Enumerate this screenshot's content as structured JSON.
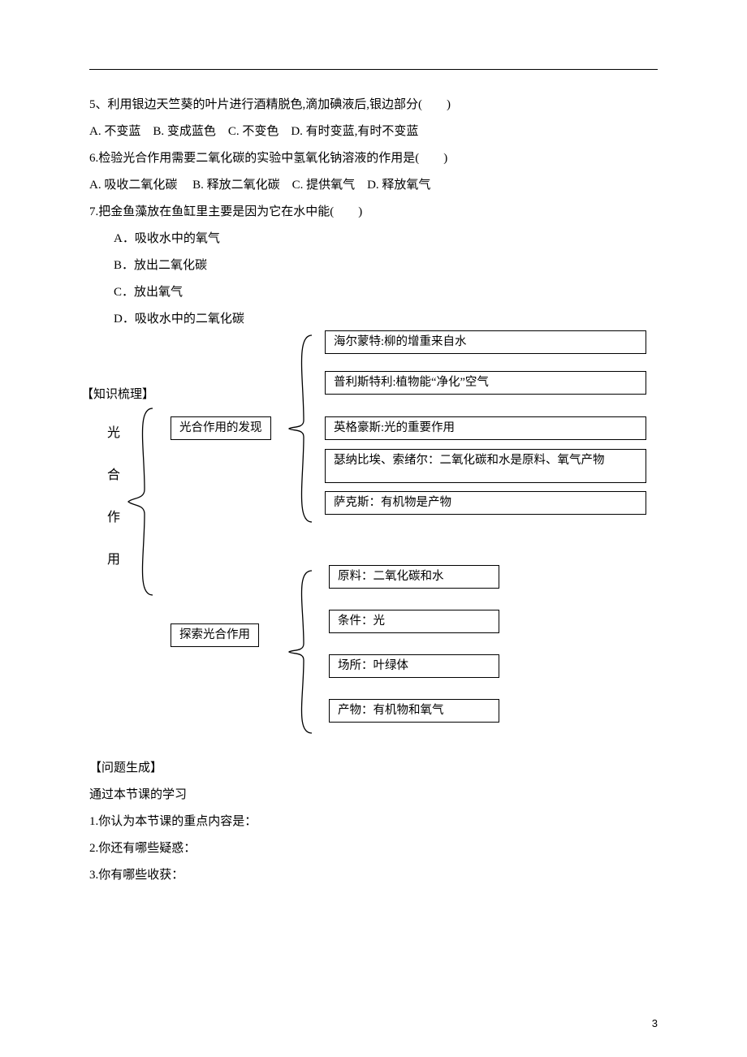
{
  "questions": {
    "q5": {
      "text": "5、利用银边天竺葵的叶片进行酒精脱色,滴加碘液后,银边部分(　　)",
      "optsLine": "A. 不变蓝　B. 变成蓝色　C. 不变色　D. 有时变蓝,有时不变蓝"
    },
    "q6": {
      "text": "6.检验光合作用需要二氧化碳的实验中氢氧化钠溶液的作用是(　　)",
      "optsLine": "A. 吸收二氧化碳　 B. 释放二氧化碳　C. 提供氧气　D. 释放氧气"
    },
    "q7": {
      "text": "7.把金鱼藻放在鱼缸里主要是因为它在水中能(　　)",
      "opts": {
        "a": "A．吸收水中的氧气",
        "b": "B．放出二氧化碳",
        "c": "C．放出氧气",
        "d": "D．吸收水中的二氧化碳"
      }
    }
  },
  "knowledge": {
    "label": "【知识梳理】",
    "root1": "光",
    "root2": "合",
    "root3": "作",
    "root4": "用",
    "branchA": "光合作用的发现",
    "branchB": "探索光合作用",
    "leavesA": {
      "l1": "海尔蒙特:柳的增重来自水",
      "l2": "普利斯特利:植物能“净化”空气",
      "l3": "英格豪斯:光的重要作用",
      "l4": "瑟纳比埃、索绪尔：二氧化碳和水是原料、氧气产物",
      "l5": "萨克斯：有机物是产物"
    },
    "leavesB": {
      "l1": "原料：二氧化碳和水",
      "l2": "条件：光",
      "l3": "场所：叶绿体",
      "l4": "产物：有机物和氧气"
    }
  },
  "problem": {
    "label": "【问题生成】",
    "intro": "通过本节课的学习",
    "p1": "1.你认为本节课的重点内容是：",
    "p2": "2.你还有哪些疑惑：",
    "p3": "3.你有哪些收获："
  },
  "pageNumber": "3"
}
